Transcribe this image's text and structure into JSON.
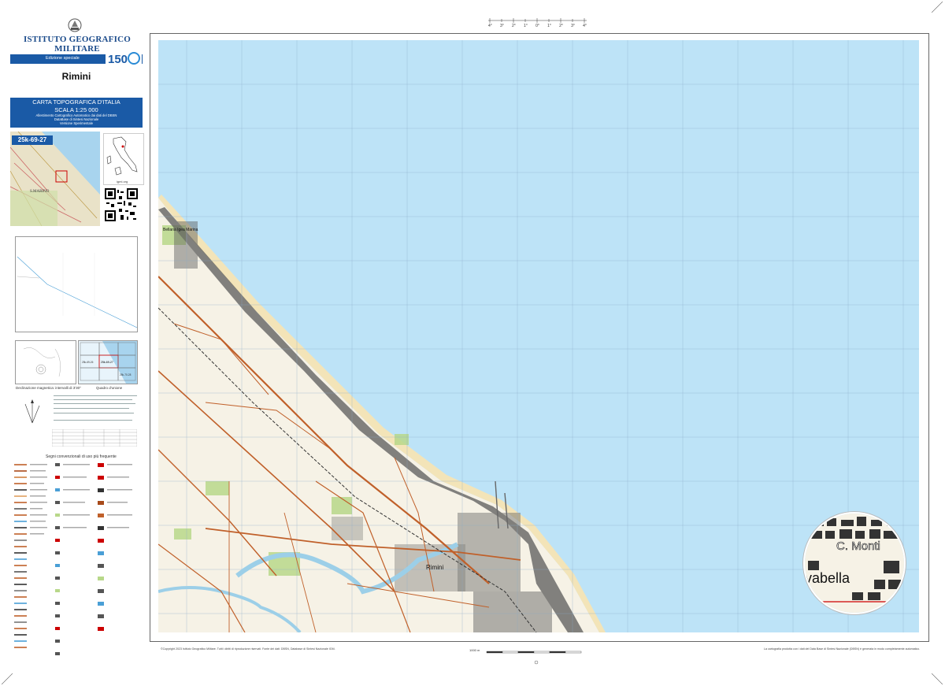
{
  "header": {
    "institute": "ISTITUTO GEOGRAFICO MILITARE",
    "edition": "Edizione speciale",
    "sheet_name": "Rimini"
  },
  "title_box": {
    "line1": "CARTA TOPOGRAFICA D'ITALIA",
    "line2": "SCALA 1:25 000",
    "line3": "Allestimento Cartografico Automatico dai dati del DBSN",
    "line4": "DataBase di Sintesi Nazionale",
    "line5": "Versione Sperimentale"
  },
  "overview": {
    "sheet_id": "25k-69-27",
    "web": "igmi.org"
  },
  "left_panel": {
    "declination_caption": "Declinazione magnetica: intervalli di 3'30\"",
    "quadrant_caption": "Quadro d'unione",
    "legend_title": "Segni convenzionali di uso più frequente",
    "grid_index": [
      "25k-69-27",
      "25k-69-26",
      "25k-70-28"
    ]
  },
  "map": {
    "place_labels": [
      "Rimini",
      "Bellaria Igea Marina"
    ],
    "top_scale_ticks": [
      "4°",
      "3°",
      "2°",
      "1°",
      "0°",
      "1°",
      "2°",
      "3°",
      "4°"
    ],
    "colors": {
      "sea": "#bde3f7",
      "land": "#f6f2e6",
      "road": "#c0602a",
      "urban": "#5a5a5a",
      "river": "#9ccfe8",
      "vegetation": "#b8d88a"
    }
  },
  "magnifier": {
    "labels": [
      "C. Monti",
      "vabella"
    ]
  },
  "footer": {
    "scale_bar_label": "1000 m",
    "copyright_left": "©Copyright 2023 Istituto Geografico Militare. Tutti i diritti di riproduzione riservati. Fonte dei dati: DBSN, Database di Sintesi Nazionale IGM.",
    "copyright_right": "La cartografia prodotta con i dati del Data Base di Sintesi Nazionale (DBSN) è generata in modo completamente automatico."
  }
}
